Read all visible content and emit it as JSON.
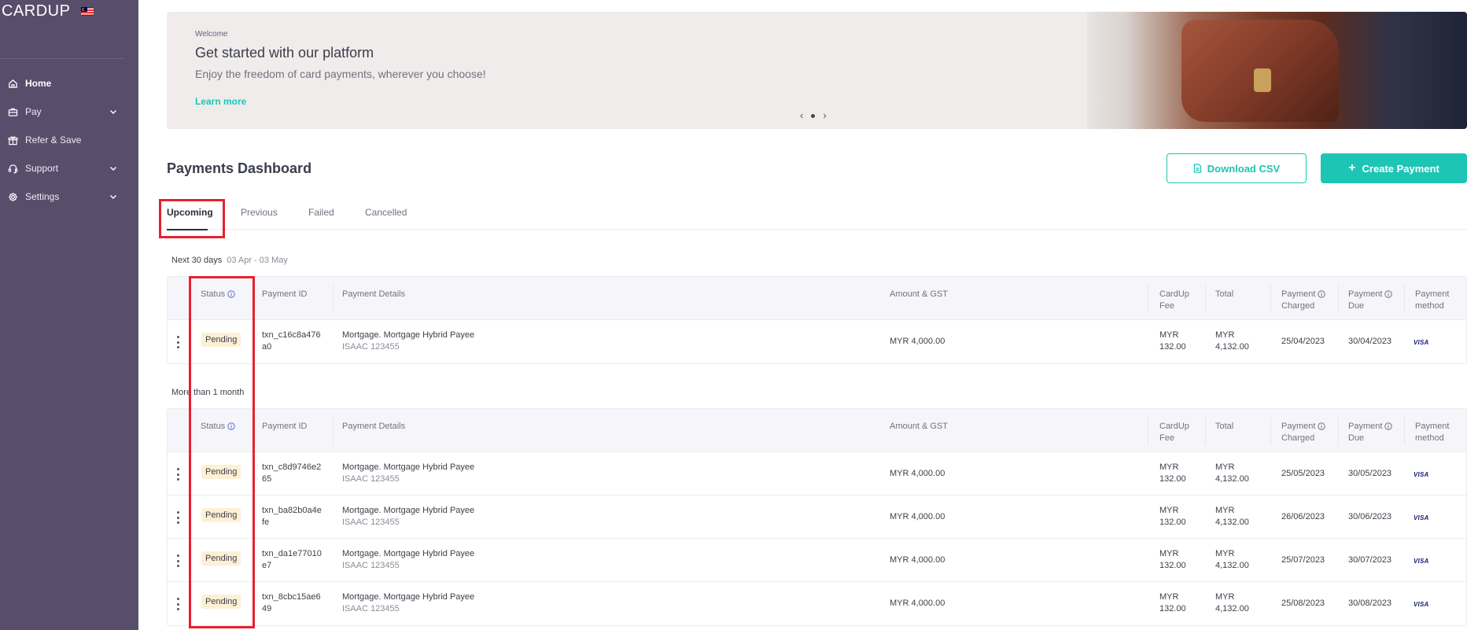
{
  "sidebar": {
    "logo": "CARDUP",
    "flag_icon": "malaysia-flag-icon",
    "items": [
      {
        "label": "Home",
        "icon": "home-icon",
        "active": true,
        "has_chevron": false
      },
      {
        "label": "Pay",
        "icon": "briefcase-icon",
        "active": false,
        "has_chevron": true
      },
      {
        "label": "Refer & Save",
        "icon": "gift-icon",
        "active": false,
        "has_chevron": false
      },
      {
        "label": "Support",
        "icon": "headset-icon",
        "active": false,
        "has_chevron": true
      },
      {
        "label": "Settings",
        "icon": "gear-icon",
        "active": false,
        "has_chevron": true
      }
    ]
  },
  "banner": {
    "welcome": "Welcome",
    "title": "Get started with our platform",
    "subtitle": "Enjoy the freedom of card payments, wherever you choose!",
    "link": "Learn more",
    "prev": "‹",
    "next": "›"
  },
  "header": {
    "title": "Payments Dashboard",
    "download_label": "Download CSV",
    "create_label": "Create Payment"
  },
  "tabs": [
    "Upcoming",
    "Previous",
    "Failed",
    "Cancelled"
  ],
  "table_headers": {
    "status": "Status",
    "payment_id": "Payment ID",
    "payment_details": "Payment Details",
    "amount": "Amount & GST",
    "fee_1": "CardUp",
    "fee_2": "Fee",
    "total": "Total",
    "charged_1": "Payment",
    "charged_2": "Charged",
    "due_1": "Payment",
    "due_2": "Due",
    "method_1": "Payment",
    "method_2": "method"
  },
  "sections": [
    {
      "label": "Next 30 days",
      "range": "03 Apr - 03 May",
      "rows": [
        {
          "status": "Pending",
          "id_1": "txn_c16c8a476",
          "id_2": "a0",
          "details": "Mortgage. Mortgage Hybrid Payee",
          "sub": "ISAAC 123455",
          "amount": "MYR 4,000.00",
          "fee_1": "MYR",
          "fee_2": "132.00",
          "total_1": "MYR",
          "total_2": "4,132.00",
          "charged": "25/04/2023",
          "due": "30/04/2023",
          "method": "VISA"
        }
      ]
    },
    {
      "label": "More than 1 month",
      "range": "",
      "rows": [
        {
          "status": "Pending",
          "id_1": "txn_c8d9746e2",
          "id_2": "65",
          "details": "Mortgage. Mortgage Hybrid Payee",
          "sub": "ISAAC 123455",
          "amount": "MYR 4,000.00",
          "fee_1": "MYR",
          "fee_2": "132.00",
          "total_1": "MYR",
          "total_2": "4,132.00",
          "charged": "25/05/2023",
          "due": "30/05/2023",
          "method": "VISA"
        },
        {
          "status": "Pending",
          "id_1": "txn_ba82b0a4e",
          "id_2": "fe",
          "details": "Mortgage. Mortgage Hybrid Payee",
          "sub": "ISAAC 123455",
          "amount": "MYR 4,000.00",
          "fee_1": "MYR",
          "fee_2": "132.00",
          "total_1": "MYR",
          "total_2": "4,132.00",
          "charged": "26/06/2023",
          "due": "30/06/2023",
          "method": "VISA"
        },
        {
          "status": "Pending",
          "id_1": "txn_da1e77010",
          "id_2": "e7",
          "details": "Mortgage. Mortgage Hybrid Payee",
          "sub": "ISAAC 123455",
          "amount": "MYR 4,000.00",
          "fee_1": "MYR",
          "fee_2": "132.00",
          "total_1": "MYR",
          "total_2": "4,132.00",
          "charged": "25/07/2023",
          "due": "30/07/2023",
          "method": "VISA"
        },
        {
          "status": "Pending",
          "id_1": "txn_8cbc15ae6",
          "id_2": "49",
          "details": "Mortgage. Mortgage Hybrid Payee",
          "sub": "ISAAC 123455",
          "amount": "MYR 4,000.00",
          "fee_1": "MYR",
          "fee_2": "132.00",
          "total_1": "MYR",
          "total_2": "4,132.00",
          "charged": "25/08/2023",
          "due": "30/08/2023",
          "method": "VISA"
        }
      ]
    }
  ],
  "colors": {
    "sidebar_bg": "#594d6c",
    "accent": "#1dc5b5",
    "highlight": "#e8202f",
    "badge_bg": "#fdf0d4"
  }
}
